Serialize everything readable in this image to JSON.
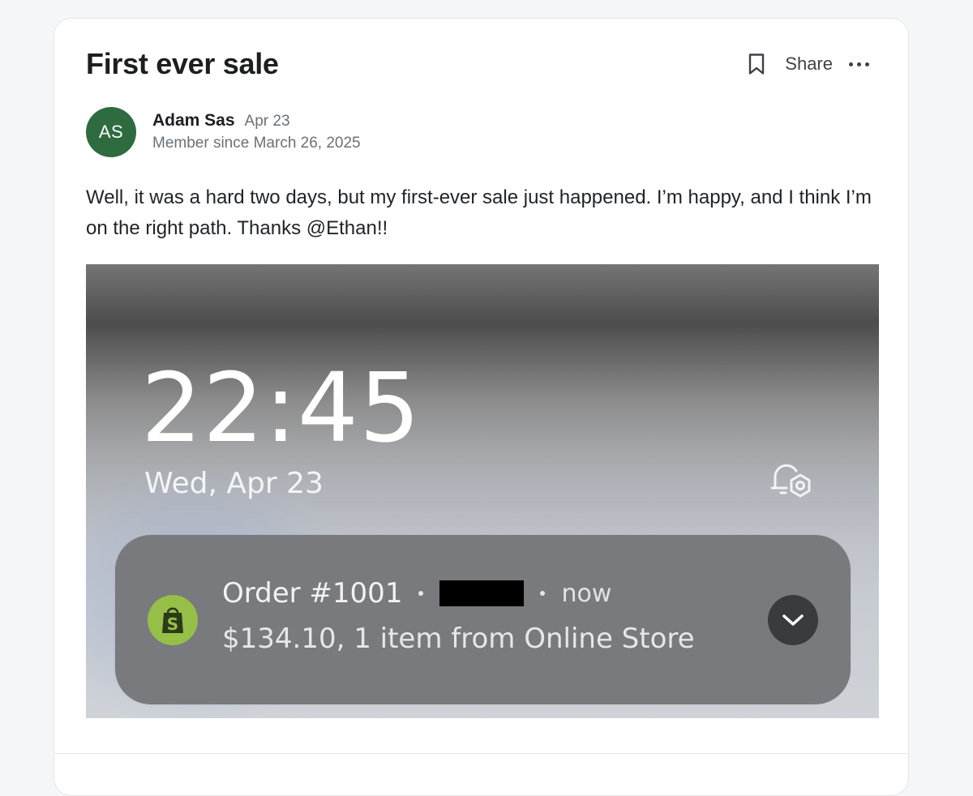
{
  "post": {
    "title": "First ever sale",
    "actions": {
      "bookmark_icon": "bookmark-icon",
      "share_label": "Share",
      "more_icon": "more-horizontal-icon"
    },
    "author": {
      "initials": "AS",
      "avatar_color": "#2e6b3f",
      "name": "Adam Sas",
      "date": "Apr 23",
      "member_since": "Member since March 26, 2025"
    },
    "body": "Well, it was a hard two days, but my first-ever sale just happened. I’m happy, and I think I’m on the right path. Thanks @Ethan!!"
  },
  "screenshot": {
    "time": "22:45",
    "date": "Wed, Apr 23",
    "alarm_icon": "alarm-settings-icon",
    "notification": {
      "app_icon": "shopify-bag-icon",
      "app_icon_color": "#95bf47",
      "title": "Order #1001",
      "time": "now",
      "detail": "$134.10, 1 item from Online Store",
      "expand_icon": "chevron-down-icon"
    }
  }
}
